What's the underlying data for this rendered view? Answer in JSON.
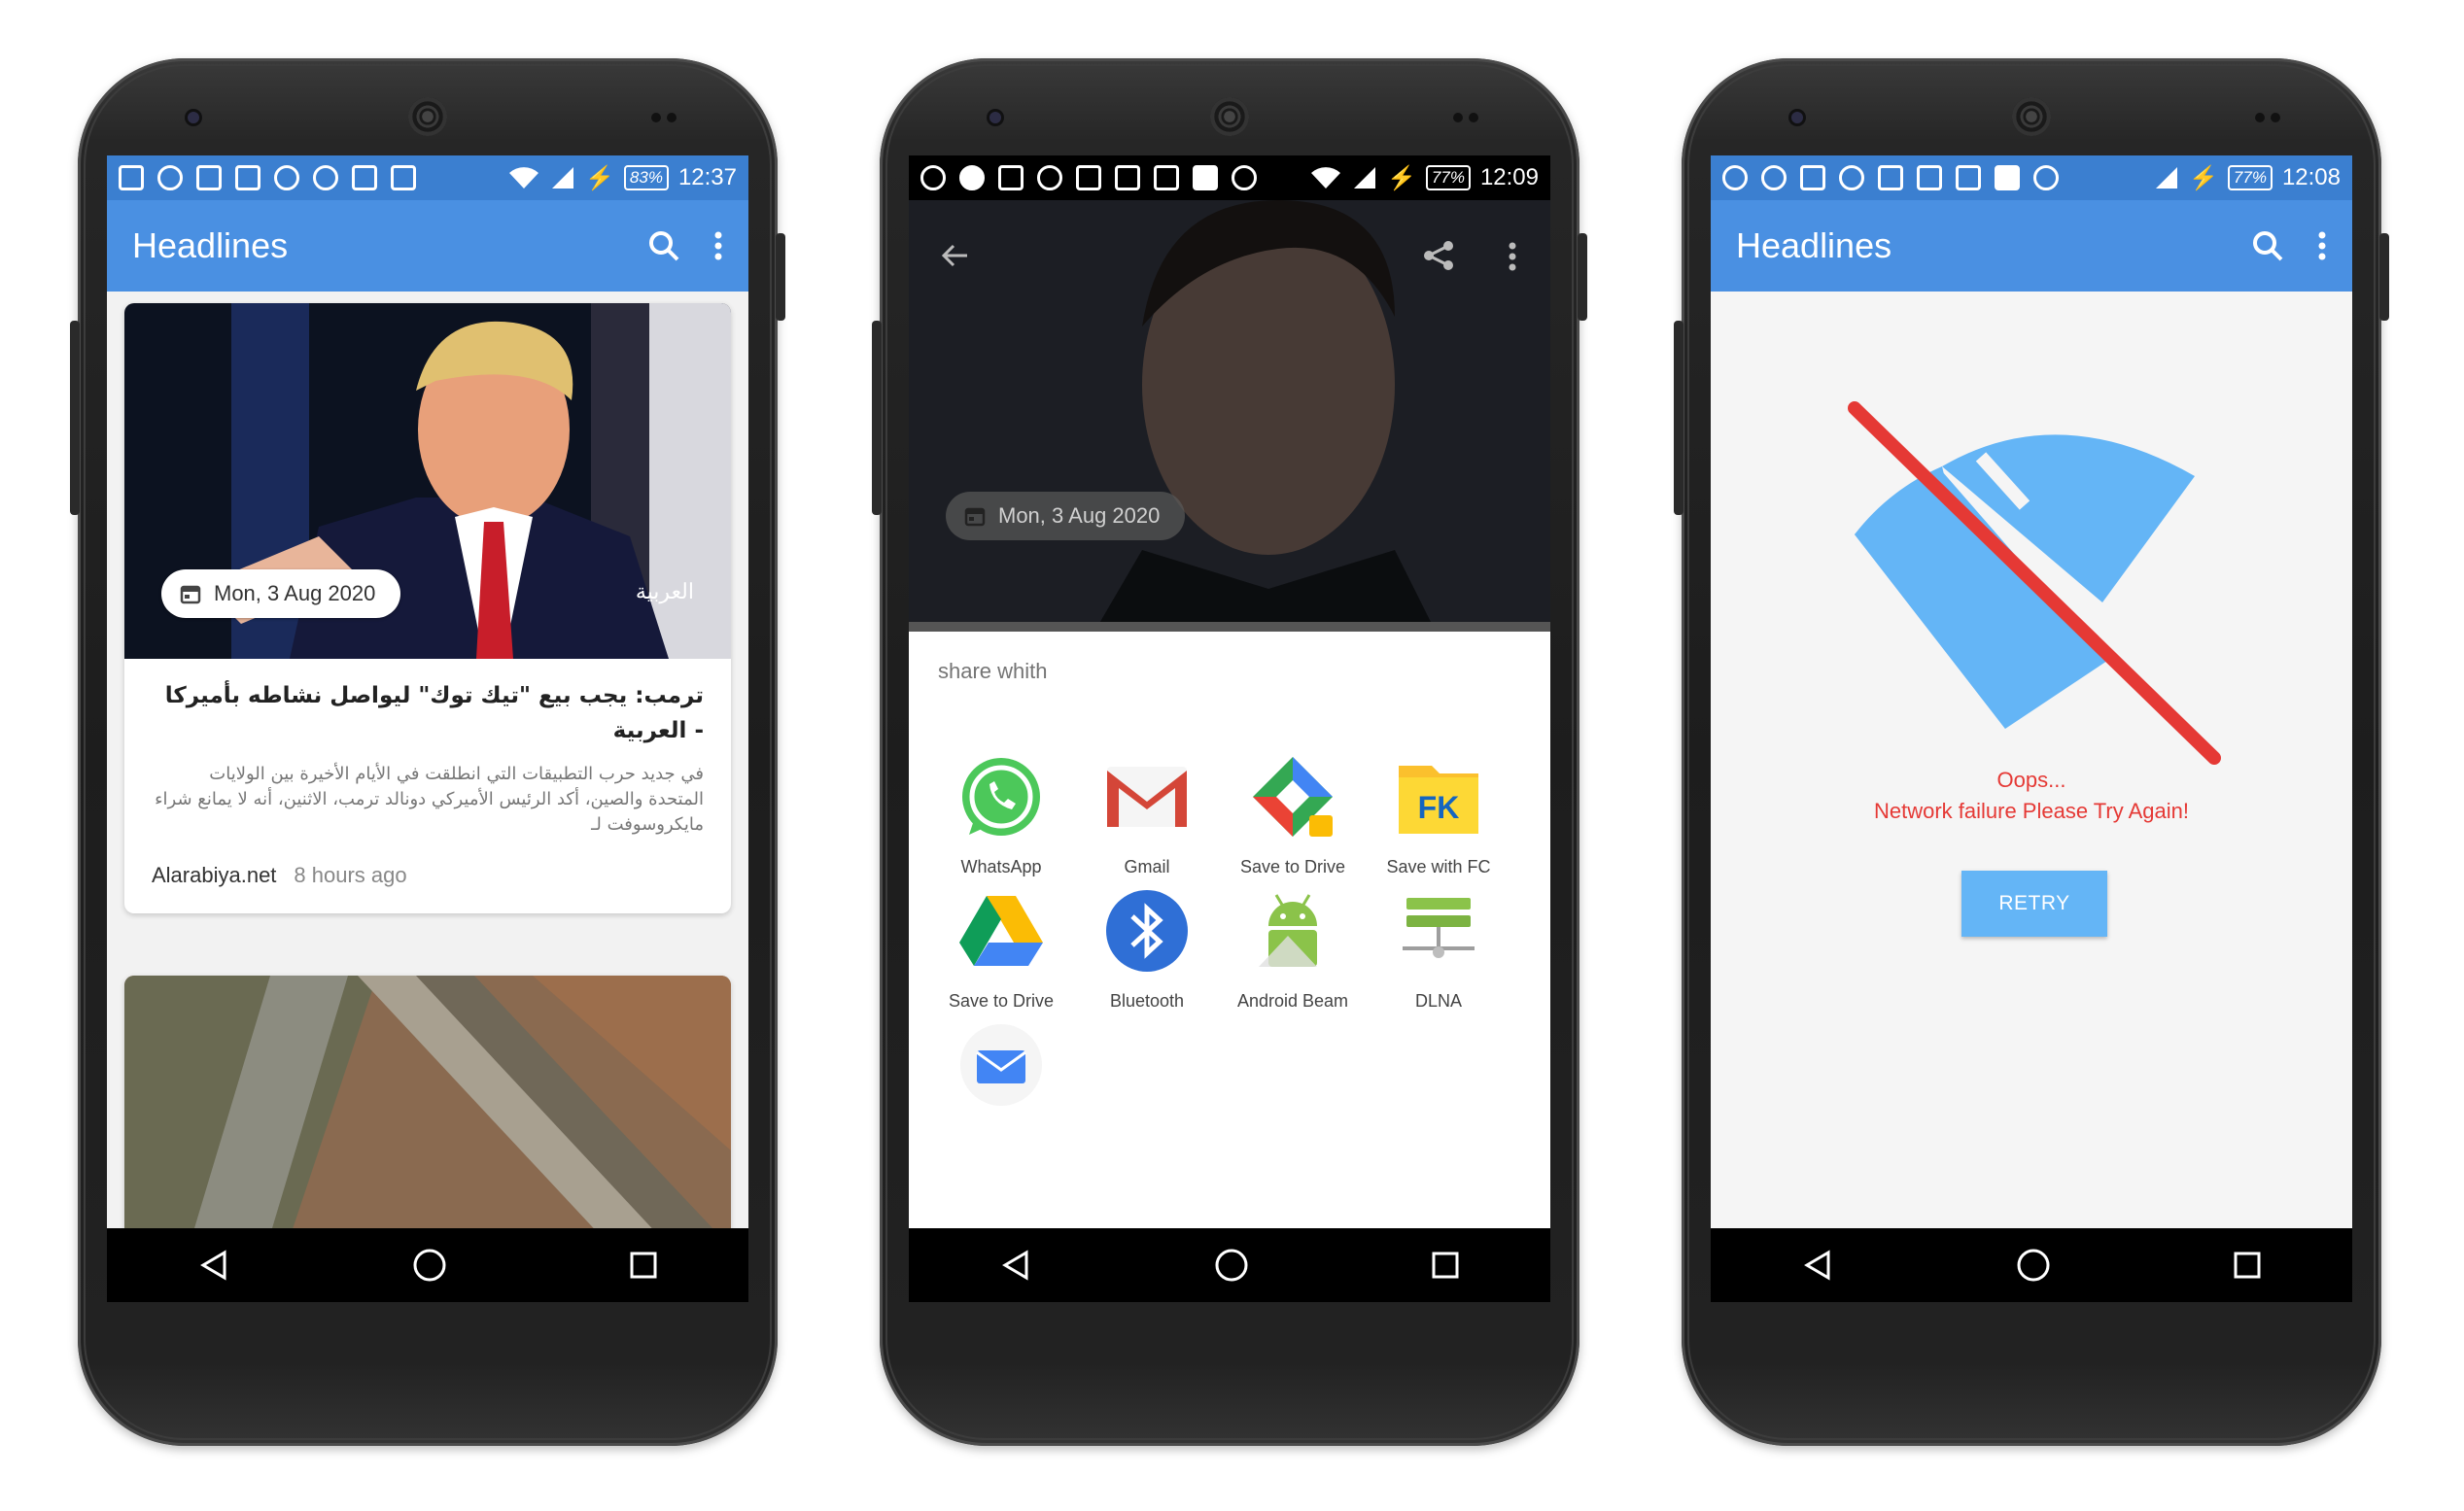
{
  "phone1": {
    "status": {
      "battery": "83%",
      "time": "12:37"
    },
    "appbar": {
      "title": "Headlines"
    },
    "cards": [
      {
        "date": "Mon, 3 Aug 2020",
        "source_tag": "العربية",
        "headline": "ترمب: يجب بيع \"تيك توك\" ليواصل نشاطه بأميركا - العربية",
        "description": "في جديد حرب التطبيقات التي انطلقت في الأيام الأخيرة بين الولايات المتحدة والصين، أكد الرئيس الأميركي دونالد ترمب، الاثنين، أنه لا يمانع شراء مايكروسوفت لـ",
        "source": "Alarabiya.net",
        "age": "8 hours ago"
      }
    ]
  },
  "phone2": {
    "status": {
      "battery": "77%",
      "time": "12:09"
    },
    "hero": {
      "date": "Mon, 3 Aug 2020"
    },
    "share": {
      "title": "share whith",
      "apps": [
        {
          "label": "WhatsApp",
          "icon": "whatsapp-icon"
        },
        {
          "label": "Gmail",
          "icon": "gmail-icon"
        },
        {
          "label": "Save to Drive",
          "icon": "drive-fc-icon"
        },
        {
          "label": "Save with FC",
          "icon": "fc-folder-icon"
        },
        {
          "label": "Save to Drive",
          "icon": "google-drive-icon"
        },
        {
          "label": "Bluetooth",
          "icon": "bluetooth-icon"
        },
        {
          "label": "Android Beam",
          "icon": "android-icon"
        },
        {
          "label": "DLNA",
          "icon": "dlna-icon"
        },
        {
          "label": "",
          "icon": "email-icon"
        }
      ]
    }
  },
  "phone3": {
    "status": {
      "battery": "77%",
      "time": "12:08"
    },
    "appbar": {
      "title": "Headlines"
    },
    "error": {
      "oops": "Oops...",
      "message": "Network failure Please Try Again!",
      "retry_label": "RETRY"
    }
  },
  "colors": {
    "primary": "#4a90e2",
    "accent_blue": "#64b5f6",
    "error_red": "#e53935"
  }
}
